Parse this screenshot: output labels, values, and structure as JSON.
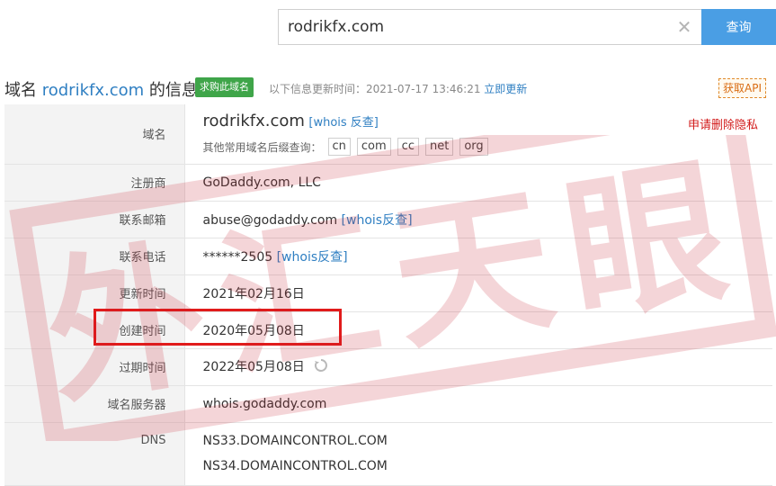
{
  "search": {
    "value": "rodrikfx.com",
    "button_label": "查询"
  },
  "header": {
    "title_prefix": "域名",
    "domain": "rodrikfx.com",
    "title_suffix": "的信息",
    "buy_label": "求购此域名",
    "update_prefix": "以下信息更新时间：",
    "update_time": "2021-07-17 13:46:21",
    "update_link": "立即更新",
    "api_label": "获取API"
  },
  "rows": {
    "domain": {
      "label": "域名",
      "value": "rodrikfx.com",
      "whois_link": "[whois 反查]",
      "suffix_label": "其他常用域名后缀查询：",
      "suffixes": [
        "cn",
        "com",
        "cc",
        "net",
        "org"
      ],
      "privacy_link": "申请删除隐私"
    },
    "registrar": {
      "label": "注册商",
      "value": "GoDaddy.com, LLC"
    },
    "email": {
      "label": "联系邮箱",
      "value": "abuse@godaddy.com",
      "link": "[whois反查]"
    },
    "phone": {
      "label": "联系电话",
      "value": "******2505",
      "link": "[whois反查]"
    },
    "updated": {
      "label": "更新时间",
      "value": "2021年02月16日"
    },
    "created": {
      "label": "创建时间",
      "value": "2020年05月08日"
    },
    "expires": {
      "label": "过期时间",
      "value": "2022年05月08日"
    },
    "nameserver": {
      "label": "域名服务器",
      "value": "whois.godaddy.com"
    },
    "dns": {
      "label": "DNS",
      "values": [
        "NS33.DOMAINCONTROL.COM",
        "NS34.DOMAINCONTROL.COM"
      ]
    }
  },
  "colors": {
    "accent": "#4a9ee4",
    "link": "#2f7fc2",
    "buy": "#3fa549",
    "highlight": "#e11b1b",
    "watermark": "#c81e2c"
  },
  "watermark": {
    "text": "外汇天眼"
  }
}
